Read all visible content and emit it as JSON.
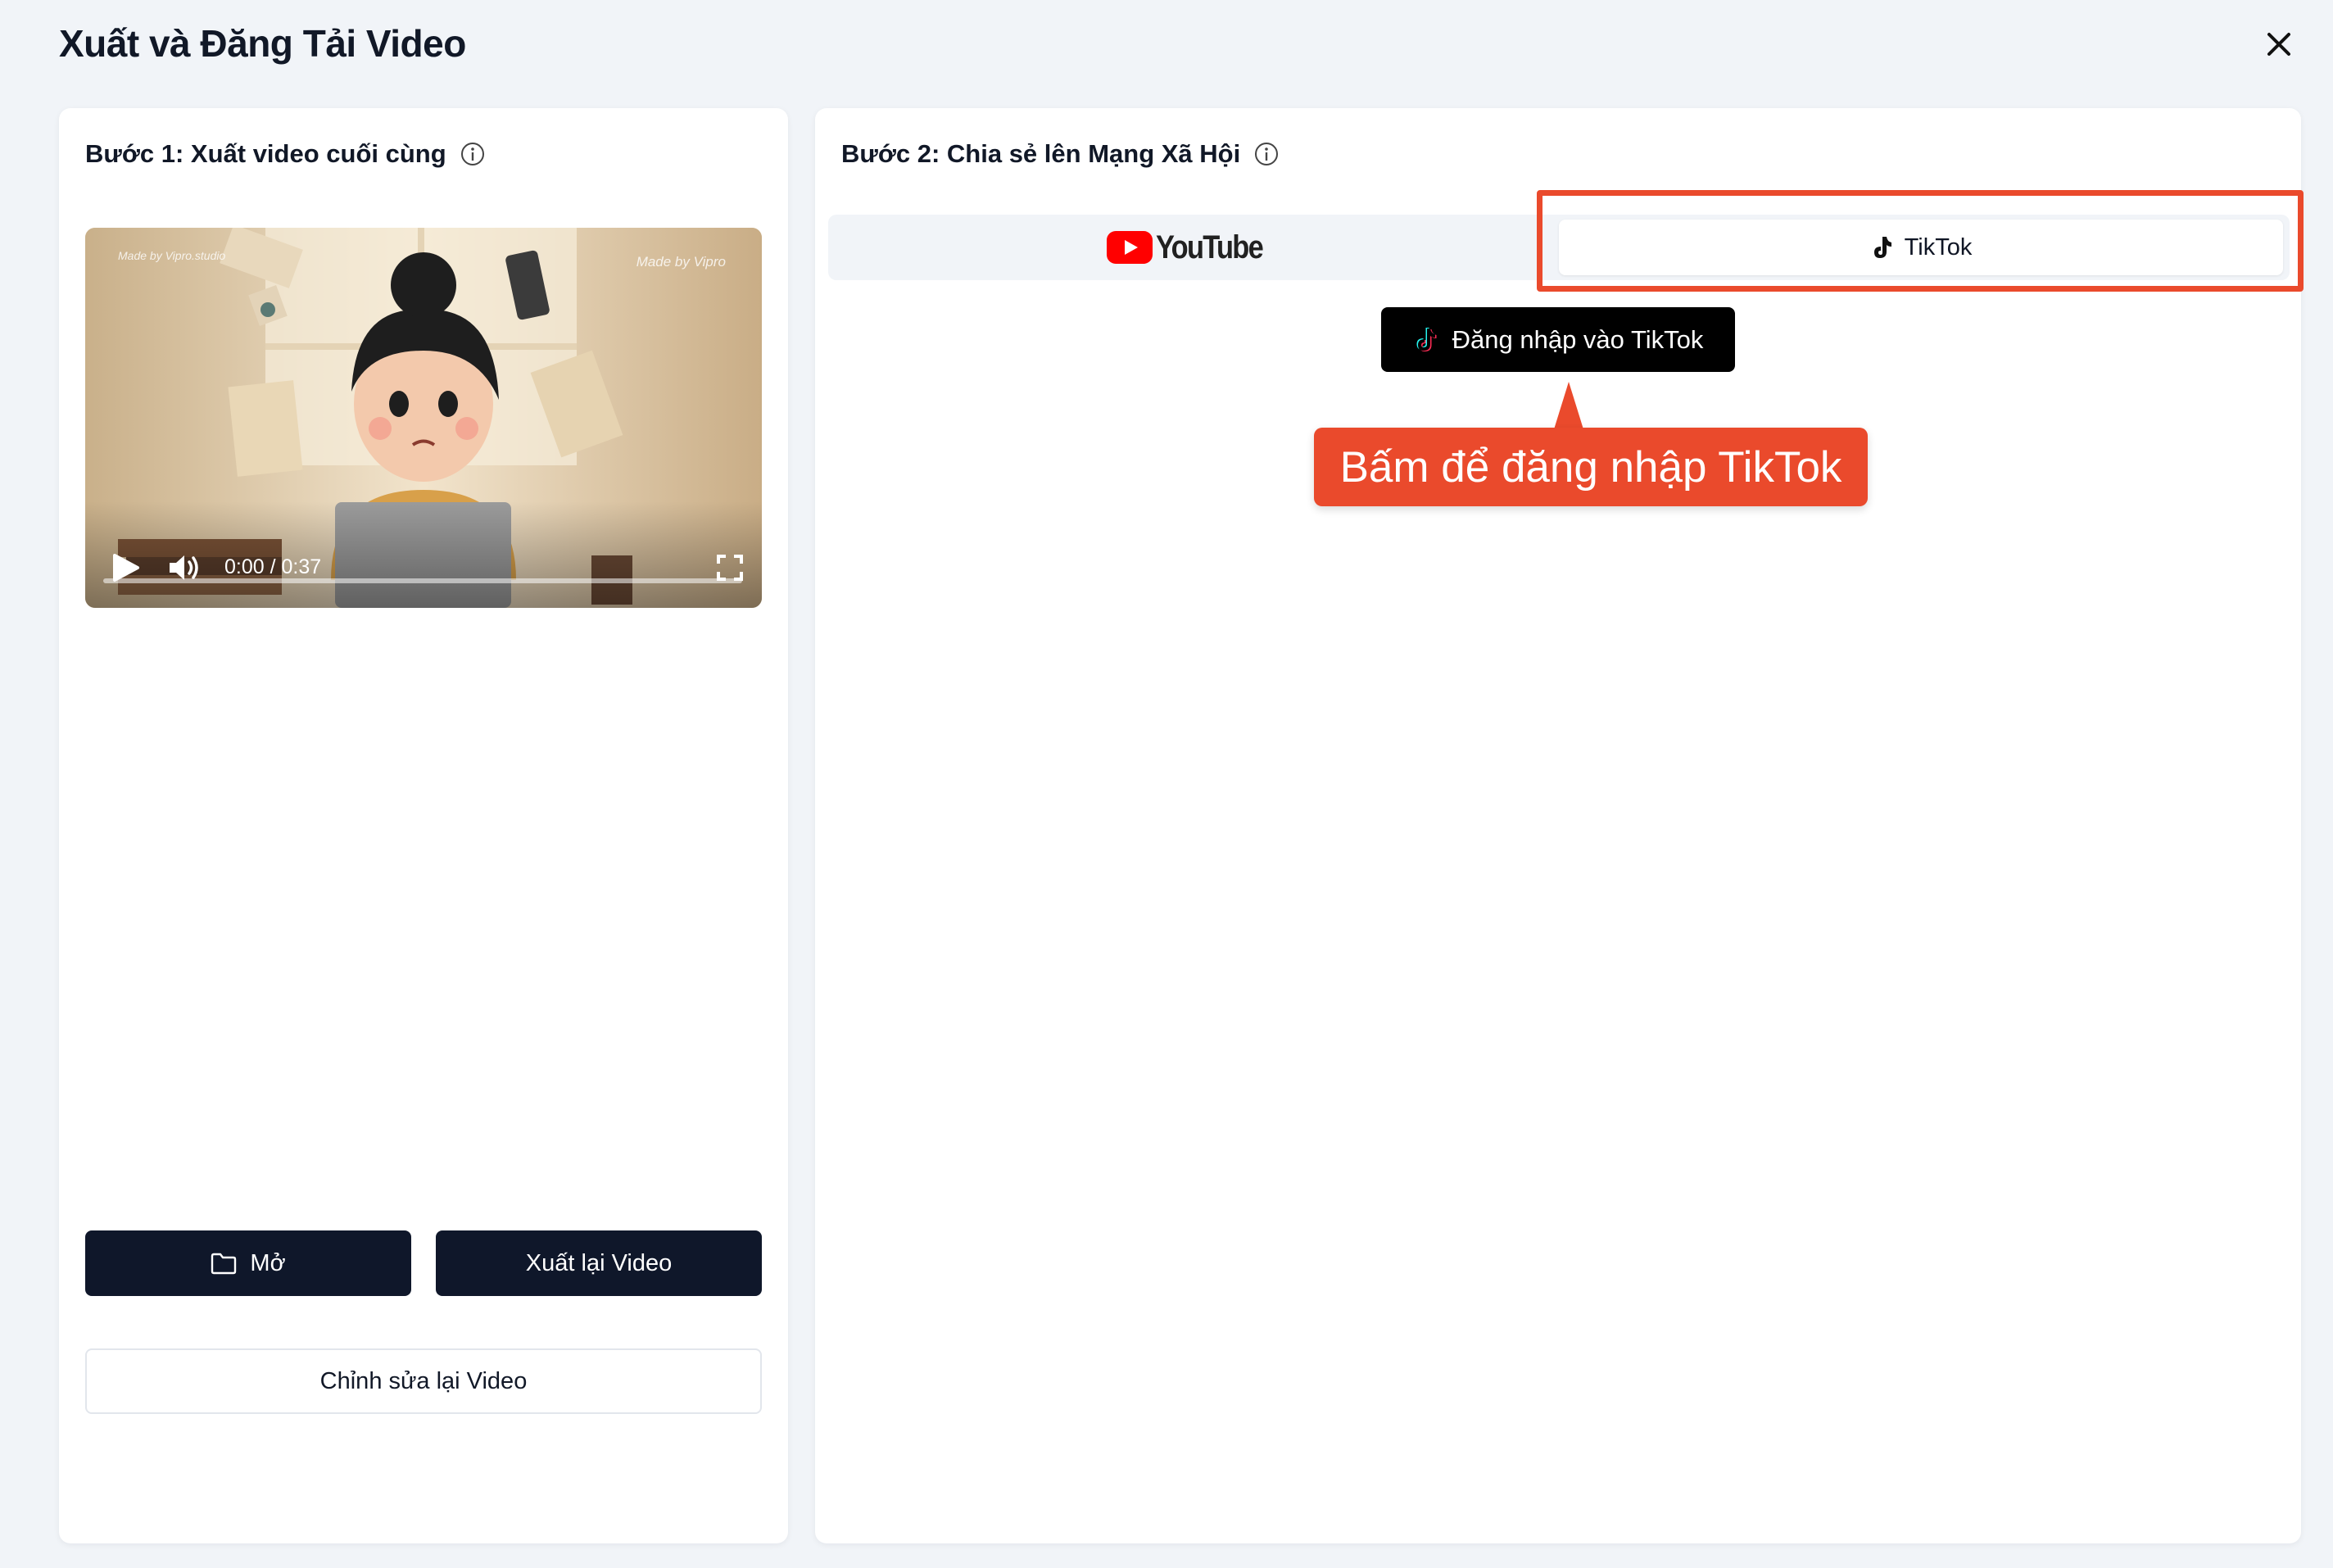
{
  "modal": {
    "title": "Xuất và Đăng Tải Video",
    "close_icon": "close-icon"
  },
  "step1": {
    "title": "Bước 1: Xuất video cuối cùng",
    "video": {
      "watermark_left": "Made by Vipro.studio",
      "watermark_right": "Made by Vipro",
      "time": "0:00 / 0:37",
      "progress": 0
    },
    "buttons": {
      "open": "Mở",
      "reexport": "Xuất lại Video",
      "edit": "Chỉnh sửa lại Video"
    }
  },
  "step2": {
    "title": "Bước 2: Chia sẻ lên Mạng Xã Hội",
    "tabs": {
      "youtube": "YouTube",
      "tiktok": "TikTok",
      "active": "tiktok"
    },
    "login_button": "Đăng nhập vào TikTok"
  },
  "annotation": {
    "callout_text": "Bấm để đăng nhập TikTok",
    "color": "#ea4a2c"
  },
  "colors": {
    "primary_dark": "#0f172a",
    "background": "#f1f4f8",
    "youtube_red": "#ff0000"
  }
}
